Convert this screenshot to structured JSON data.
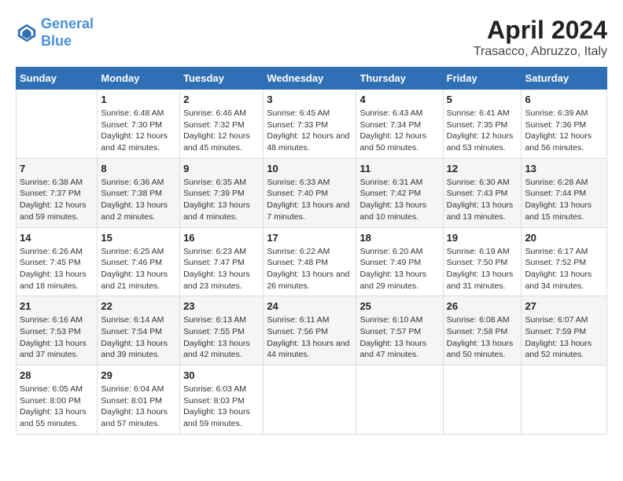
{
  "logo": {
    "line1": "General",
    "line2": "Blue"
  },
  "title": "April 2024",
  "subtitle": "Trasacco, Abruzzo, Italy",
  "days_header": [
    "Sunday",
    "Monday",
    "Tuesday",
    "Wednesday",
    "Thursday",
    "Friday",
    "Saturday"
  ],
  "weeks": [
    [
      {
        "num": "",
        "sunrise": "",
        "sunset": "",
        "daylight": ""
      },
      {
        "num": "1",
        "sunrise": "Sunrise: 6:48 AM",
        "sunset": "Sunset: 7:30 PM",
        "daylight": "Daylight: 12 hours and 42 minutes."
      },
      {
        "num": "2",
        "sunrise": "Sunrise: 6:46 AM",
        "sunset": "Sunset: 7:32 PM",
        "daylight": "Daylight: 12 hours and 45 minutes."
      },
      {
        "num": "3",
        "sunrise": "Sunrise: 6:45 AM",
        "sunset": "Sunset: 7:33 PM",
        "daylight": "Daylight: 12 hours and 48 minutes."
      },
      {
        "num": "4",
        "sunrise": "Sunrise: 6:43 AM",
        "sunset": "Sunset: 7:34 PM",
        "daylight": "Daylight: 12 hours and 50 minutes."
      },
      {
        "num": "5",
        "sunrise": "Sunrise: 6:41 AM",
        "sunset": "Sunset: 7:35 PM",
        "daylight": "Daylight: 12 hours and 53 minutes."
      },
      {
        "num": "6",
        "sunrise": "Sunrise: 6:39 AM",
        "sunset": "Sunset: 7:36 PM",
        "daylight": "Daylight: 12 hours and 56 minutes."
      }
    ],
    [
      {
        "num": "7",
        "sunrise": "Sunrise: 6:38 AM",
        "sunset": "Sunset: 7:37 PM",
        "daylight": "Daylight: 12 hours and 59 minutes."
      },
      {
        "num": "8",
        "sunrise": "Sunrise: 6:36 AM",
        "sunset": "Sunset: 7:38 PM",
        "daylight": "Daylight: 13 hours and 2 minutes."
      },
      {
        "num": "9",
        "sunrise": "Sunrise: 6:35 AM",
        "sunset": "Sunset: 7:39 PM",
        "daylight": "Daylight: 13 hours and 4 minutes."
      },
      {
        "num": "10",
        "sunrise": "Sunrise: 6:33 AM",
        "sunset": "Sunset: 7:40 PM",
        "daylight": "Daylight: 13 hours and 7 minutes."
      },
      {
        "num": "11",
        "sunrise": "Sunrise: 6:31 AM",
        "sunset": "Sunset: 7:42 PM",
        "daylight": "Daylight: 13 hours and 10 minutes."
      },
      {
        "num": "12",
        "sunrise": "Sunrise: 6:30 AM",
        "sunset": "Sunset: 7:43 PM",
        "daylight": "Daylight: 13 hours and 13 minutes."
      },
      {
        "num": "13",
        "sunrise": "Sunrise: 6:28 AM",
        "sunset": "Sunset: 7:44 PM",
        "daylight": "Daylight: 13 hours and 15 minutes."
      }
    ],
    [
      {
        "num": "14",
        "sunrise": "Sunrise: 6:26 AM",
        "sunset": "Sunset: 7:45 PM",
        "daylight": "Daylight: 13 hours and 18 minutes."
      },
      {
        "num": "15",
        "sunrise": "Sunrise: 6:25 AM",
        "sunset": "Sunset: 7:46 PM",
        "daylight": "Daylight: 13 hours and 21 minutes."
      },
      {
        "num": "16",
        "sunrise": "Sunrise: 6:23 AM",
        "sunset": "Sunset: 7:47 PM",
        "daylight": "Daylight: 13 hours and 23 minutes."
      },
      {
        "num": "17",
        "sunrise": "Sunrise: 6:22 AM",
        "sunset": "Sunset: 7:48 PM",
        "daylight": "Daylight: 13 hours and 26 minutes."
      },
      {
        "num": "18",
        "sunrise": "Sunrise: 6:20 AM",
        "sunset": "Sunset: 7:49 PM",
        "daylight": "Daylight: 13 hours and 29 minutes."
      },
      {
        "num": "19",
        "sunrise": "Sunrise: 6:19 AM",
        "sunset": "Sunset: 7:50 PM",
        "daylight": "Daylight: 13 hours and 31 minutes."
      },
      {
        "num": "20",
        "sunrise": "Sunrise: 6:17 AM",
        "sunset": "Sunset: 7:52 PM",
        "daylight": "Daylight: 13 hours and 34 minutes."
      }
    ],
    [
      {
        "num": "21",
        "sunrise": "Sunrise: 6:16 AM",
        "sunset": "Sunset: 7:53 PM",
        "daylight": "Daylight: 13 hours and 37 minutes."
      },
      {
        "num": "22",
        "sunrise": "Sunrise: 6:14 AM",
        "sunset": "Sunset: 7:54 PM",
        "daylight": "Daylight: 13 hours and 39 minutes."
      },
      {
        "num": "23",
        "sunrise": "Sunrise: 6:13 AM",
        "sunset": "Sunset: 7:55 PM",
        "daylight": "Daylight: 13 hours and 42 minutes."
      },
      {
        "num": "24",
        "sunrise": "Sunrise: 6:11 AM",
        "sunset": "Sunset: 7:56 PM",
        "daylight": "Daylight: 13 hours and 44 minutes."
      },
      {
        "num": "25",
        "sunrise": "Sunrise: 6:10 AM",
        "sunset": "Sunset: 7:57 PM",
        "daylight": "Daylight: 13 hours and 47 minutes."
      },
      {
        "num": "26",
        "sunrise": "Sunrise: 6:08 AM",
        "sunset": "Sunset: 7:58 PM",
        "daylight": "Daylight: 13 hours and 50 minutes."
      },
      {
        "num": "27",
        "sunrise": "Sunrise: 6:07 AM",
        "sunset": "Sunset: 7:59 PM",
        "daylight": "Daylight: 13 hours and 52 minutes."
      }
    ],
    [
      {
        "num": "28",
        "sunrise": "Sunrise: 6:05 AM",
        "sunset": "Sunset: 8:00 PM",
        "daylight": "Daylight: 13 hours and 55 minutes."
      },
      {
        "num": "29",
        "sunrise": "Sunrise: 6:04 AM",
        "sunset": "Sunset: 8:01 PM",
        "daylight": "Daylight: 13 hours and 57 minutes."
      },
      {
        "num": "30",
        "sunrise": "Sunrise: 6:03 AM",
        "sunset": "Sunset: 8:03 PM",
        "daylight": "Daylight: 13 hours and 59 minutes."
      },
      {
        "num": "",
        "sunrise": "",
        "sunset": "",
        "daylight": ""
      },
      {
        "num": "",
        "sunrise": "",
        "sunset": "",
        "daylight": ""
      },
      {
        "num": "",
        "sunrise": "",
        "sunset": "",
        "daylight": ""
      },
      {
        "num": "",
        "sunrise": "",
        "sunset": "",
        "daylight": ""
      }
    ]
  ]
}
